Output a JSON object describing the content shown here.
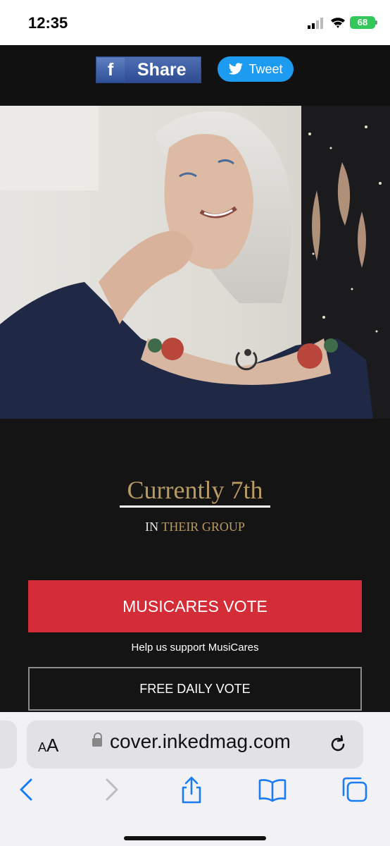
{
  "status_bar": {
    "time": "12:35",
    "battery": "68"
  },
  "share_bar": {
    "facebook_logo": "f",
    "facebook_label": "Share",
    "tweet_label": "Tweet"
  },
  "ranking": {
    "title": "Currently 7th",
    "prefix": "IN",
    "suffix": "THEIR GROUP"
  },
  "actions": {
    "musicares_vote": "MUSICARES VOTE",
    "musicares_help": "Help us support MusiCares",
    "free_vote": "FREE DAILY VOTE"
  },
  "browser": {
    "aa_small": "A",
    "aa_large": "A",
    "url": "cover.inkedmag.com"
  },
  "icons": [
    "signal-icon",
    "wifi-icon",
    "battery-icon",
    "facebook-icon",
    "twitter-bird-icon",
    "lock-icon",
    "reload-icon",
    "back-icon",
    "forward-icon",
    "share-icon",
    "bookmarks-icon",
    "tabs-icon"
  ],
  "colors": {
    "accent_gold": "#b89a63",
    "vote_red": "#d52d38",
    "twitter_blue": "#1d9bf0",
    "facebook_blue": "#3b5998"
  }
}
